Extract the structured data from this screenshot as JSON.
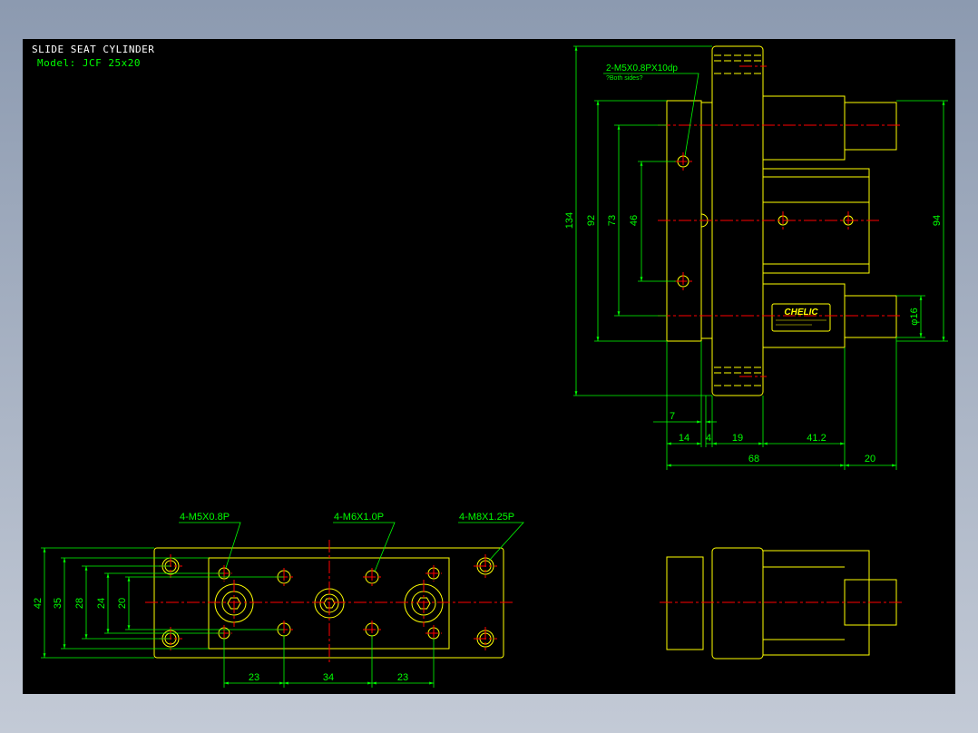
{
  "drawing": {
    "title": "SLIDE SEAT CYLINDER",
    "model": "Model:  JCF 25x20",
    "brand": "CHELIC",
    "colors": {
      "background": "#000000",
      "outline": "#ffff00",
      "dimension": "#00ff00",
      "centerline": "#ff0000",
      "title_text": "#ffffff"
    }
  },
  "side_view": {
    "callout_thread": "2-M5X0.8PX10dp",
    "callout_note": "?Both sides?",
    "dims": {
      "d134": "134",
      "d92": "92",
      "d73": "73",
      "d46": "46",
      "d94": "94",
      "d16": "φ16",
      "d7": "7",
      "d14": "14",
      "d4": "4",
      "d19": "19",
      "d41_2": "41.2",
      "d68": "68",
      "d20": "20"
    }
  },
  "bottom_view": {
    "callout_m5": "4-M5X0.8P",
    "callout_m6": "4-M6X1.0P",
    "callout_m8": "4-M8X1.25P",
    "dims": {
      "d42": "42",
      "d35": "35",
      "d28": "28",
      "d24": "24",
      "d20": "20",
      "d23a": "23",
      "d34": "34",
      "d23b": "23"
    }
  }
}
